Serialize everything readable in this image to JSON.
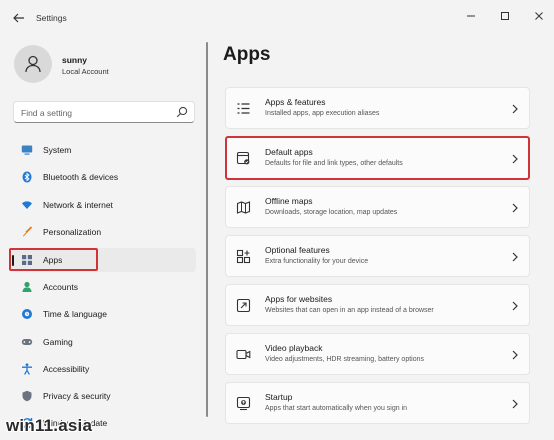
{
  "window": {
    "title": "Settings"
  },
  "profile": {
    "name": "sunny",
    "account": "Local Account"
  },
  "search": {
    "placeholder": "Find a setting"
  },
  "sidebar": {
    "items": [
      {
        "label": "System",
        "icon": "system-icon",
        "active": false
      },
      {
        "label": "Bluetooth & devices",
        "icon": "bluetooth-icon",
        "active": false
      },
      {
        "label": "Network & internet",
        "icon": "wifi-icon",
        "active": false
      },
      {
        "label": "Personalization",
        "icon": "brush-icon",
        "active": false
      },
      {
        "label": "Apps",
        "icon": "apps-icon",
        "active": true
      },
      {
        "label": "Accounts",
        "icon": "person-icon",
        "active": false
      },
      {
        "label": "Time & language",
        "icon": "globe-clock-icon",
        "active": false
      },
      {
        "label": "Gaming",
        "icon": "gamepad-icon",
        "active": false
      },
      {
        "label": "Accessibility",
        "icon": "accessibility-icon",
        "active": false
      },
      {
        "label": "Privacy & security",
        "icon": "shield-icon",
        "active": false
      },
      {
        "label": "Windows Update",
        "icon": "update-icon",
        "active": false
      }
    ]
  },
  "main": {
    "title": "Apps",
    "cards": [
      {
        "title": "Apps & features",
        "subtitle": "Installed apps, app execution aliases",
        "icon": "list-icon"
      },
      {
        "title": "Default apps",
        "subtitle": "Defaults for file and link types, other defaults",
        "icon": "default-apps-icon"
      },
      {
        "title": "Offline maps",
        "subtitle": "Downloads, storage location, map updates",
        "icon": "map-icon"
      },
      {
        "title": "Optional features",
        "subtitle": "Extra functionality for your device",
        "icon": "grid-plus-icon"
      },
      {
        "title": "Apps for websites",
        "subtitle": "Websites that can open in an app instead of a browser",
        "icon": "open-app-icon"
      },
      {
        "title": "Video playback",
        "subtitle": "Video adjustments, HDR streaming, battery options",
        "icon": "video-icon"
      },
      {
        "title": "Startup",
        "subtitle": "Apps that start automatically when you sign in",
        "icon": "startup-icon"
      }
    ]
  },
  "watermark": "win11.asia",
  "colors": {
    "highlight": "#d13438",
    "accent": "#0067c0"
  }
}
